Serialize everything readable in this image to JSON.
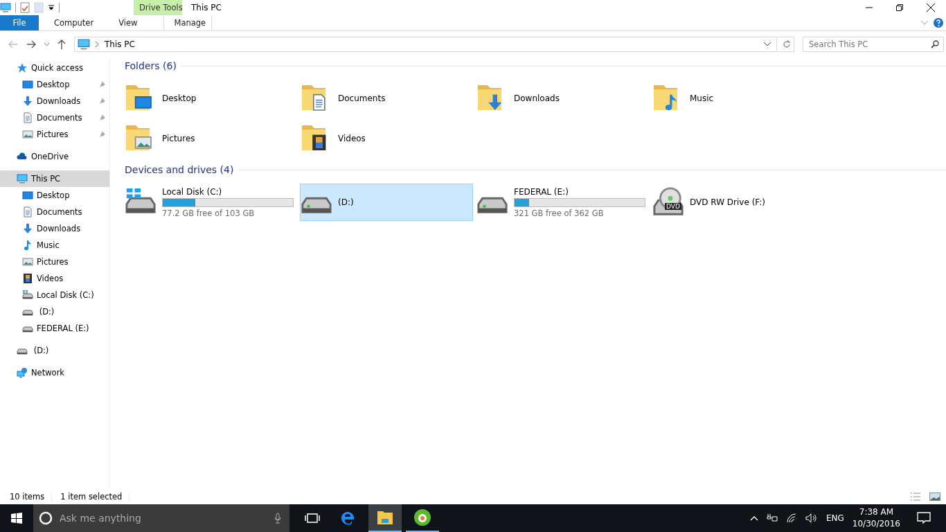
{
  "window": {
    "title": "This PC",
    "context_group": "Drive Tools"
  },
  "ribbon_tabs": [
    {
      "label": "File",
      "kind": "file"
    },
    {
      "label": "Computer",
      "kind": "tab"
    },
    {
      "label": "View",
      "kind": "tab"
    },
    {
      "label": "Manage",
      "kind": "context"
    }
  ],
  "address": {
    "path": "This PC"
  },
  "search": {
    "placeholder": "Search This PC"
  },
  "sidebar": {
    "items": [
      {
        "label": "Quick access",
        "kind": "star",
        "selected": false,
        "children": [
          {
            "label": "Desktop",
            "kind": "desktop",
            "pinned": true,
            "selected": false
          },
          {
            "label": "Downloads",
            "kind": "downloads",
            "pinned": true,
            "selected": false
          },
          {
            "label": "Documents",
            "kind": "documents",
            "pinned": true,
            "selected": false
          },
          {
            "label": "Pictures",
            "kind": "pictures",
            "pinned": true,
            "selected": false
          }
        ]
      },
      {
        "label": "OneDrive",
        "kind": "onedrive",
        "selected": false
      },
      {
        "label": "This PC",
        "kind": "pc",
        "selected": true,
        "children": [
          {
            "label": "Desktop",
            "kind": "desktop",
            "pinned": false,
            "selected": false
          },
          {
            "label": "Documents",
            "kind": "documents",
            "pinned": false,
            "selected": false
          },
          {
            "label": "Downloads",
            "kind": "downloads",
            "pinned": false,
            "selected": false
          },
          {
            "label": "Music",
            "kind": "music",
            "pinned": false,
            "selected": false
          },
          {
            "label": "Pictures",
            "kind": "pictures",
            "pinned": false,
            "selected": false
          },
          {
            "label": "Videos",
            "kind": "videos",
            "pinned": false,
            "selected": false
          },
          {
            "label": "Local Disk (C:)",
            "kind": "windisk",
            "pinned": false,
            "selected": false
          },
          {
            "label": " (D:)",
            "kind": "disk",
            "pinned": false,
            "selected": false
          },
          {
            "label": "FEDERAL (E:)",
            "kind": "disk",
            "pinned": false,
            "selected": false
          }
        ]
      },
      {
        "label": " (D:)",
        "kind": "disk",
        "selected": false
      },
      {
        "label": "Network",
        "kind": "network",
        "selected": false
      }
    ]
  },
  "folders": {
    "heading": "Folders (6)",
    "items": [
      {
        "name": "Desktop",
        "kind": "desktop"
      },
      {
        "name": "Documents",
        "kind": "documents"
      },
      {
        "name": "Downloads",
        "kind": "downloads"
      },
      {
        "name": "Music",
        "kind": "music"
      },
      {
        "name": "Pictures",
        "kind": "pictures"
      },
      {
        "name": "Videos",
        "kind": "videos"
      }
    ]
  },
  "drives": {
    "heading": "Devices and drives (4)",
    "items": [
      {
        "name": "Local Disk (C:)",
        "kind": "windisk",
        "level": 0.25,
        "free": "77.2 GB free of 103 GB",
        "selected": false
      },
      {
        "name": "(D:)",
        "kind": "disk",
        "selected": true
      },
      {
        "name": "FEDERAL (E:)",
        "kind": "disk",
        "level": 0.11,
        "free": "321 GB free of 362 GB",
        "selected": false
      },
      {
        "name": "DVD RW Drive (F:)",
        "kind": "dvd",
        "selected": false,
        "badge": "DVD"
      }
    ]
  },
  "status_bar": {
    "count": "10 items",
    "selection": "1 item selected"
  },
  "taskbar": {
    "search_placeholder": "Ask me anything",
    "apps": [
      {
        "kind": "edge",
        "active": false,
        "running": false
      },
      {
        "kind": "explorer",
        "active": true,
        "running": true
      },
      {
        "kind": "green",
        "active": false,
        "running": true
      }
    ],
    "language": "ENG",
    "time": "7:38 AM",
    "date": "10/30/2016"
  }
}
